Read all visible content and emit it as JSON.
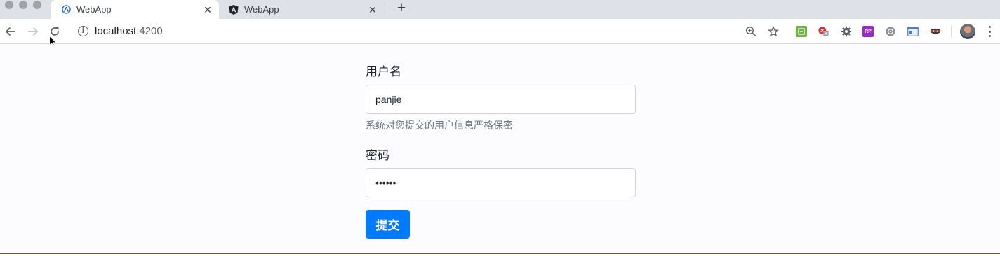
{
  "browser": {
    "tabs": [
      {
        "title": "WebApp",
        "active": true,
        "favicon": "angular-outline-icon"
      },
      {
        "title": "WebApp",
        "active": false,
        "favicon": "angular-logo-icon"
      }
    ],
    "new_tab_label": "+",
    "close_glyph": "✕",
    "address": {
      "host": "localhost",
      "port": ":4200"
    },
    "info_glyph": "i"
  },
  "form": {
    "username_label": "用户名",
    "username_value": "panjie",
    "username_help": "系统对您提交的用户信息严格保密",
    "password_label": "密码",
    "password_value": "••••••",
    "submit_label": "提交"
  },
  "colors": {
    "primary": "#007bff",
    "tabstrip": "#dee1e6"
  }
}
